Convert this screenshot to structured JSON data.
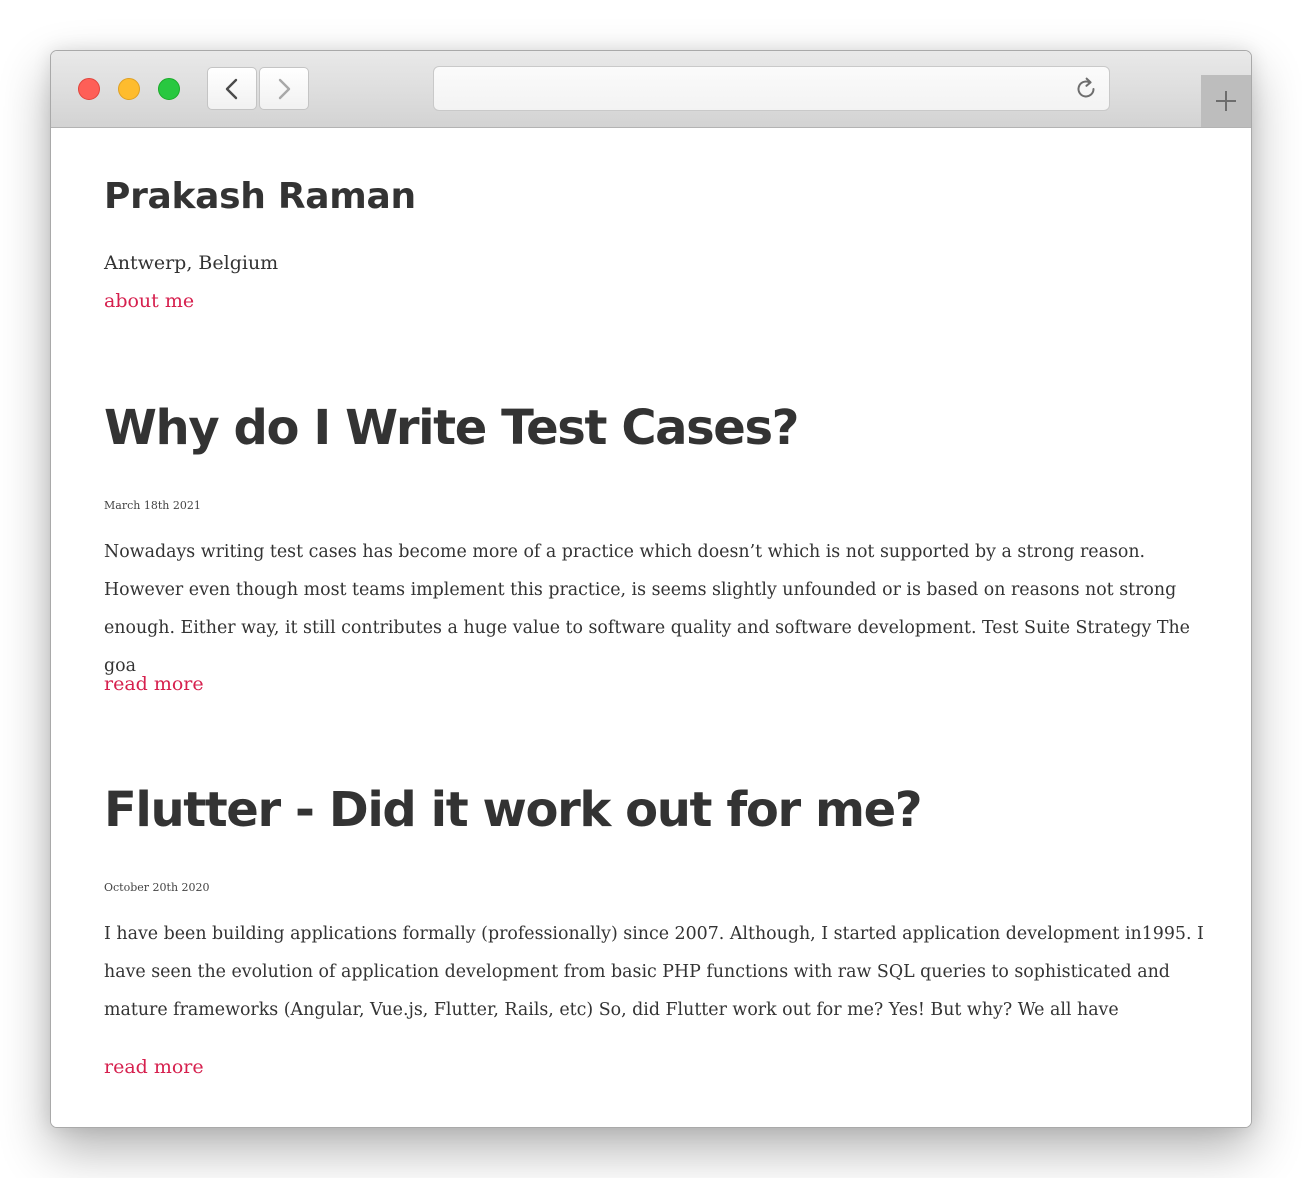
{
  "browser": {
    "url": "",
    "controls": {
      "close": "close-window-icon",
      "minimize": "minimize-window-icon",
      "maximize": "maximize-window-icon",
      "back": "chevron-left-icon",
      "forward": "chevron-right-icon",
      "reload": "reload-icon",
      "new_tab": "plus-icon"
    },
    "colors": {
      "close": "#fe5f57",
      "minimize": "#febc2e",
      "maximize": "#28c840"
    }
  },
  "site": {
    "title": "Prakash Raman",
    "location": "Antwerp, Belgium",
    "about_link": "about me",
    "accent_color": "#d6204e",
    "text_color": "#333333"
  },
  "posts": [
    {
      "title": "Why do I Write Test Cases?",
      "date": "March 18th 2021",
      "excerpt": "Nowadays writing test cases has become more of a practice which doesn’t which is not supported by a strong reason. However even though most teams implement this practice, is seems slightly unfounded or is based on reasons not strong enough. Either way, it still contributes a huge value to software quality and software development. Test Suite Strategy The goa",
      "read_more": "read more"
    },
    {
      "title": "Flutter - Did it work out for me?",
      "date": "October 20th 2020",
      "excerpt": "I have been building applications formally (professionally) since 2007. Although, I started application development in1995. I have seen the evolution of application development from basic PHP functions with raw SQL queries to sophisticated and mature frameworks (Angular, Vue.js, Flutter, Rails, etc) So, did Flutter work out for me? Yes! But why? We all have",
      "read_more": "read more"
    }
  ]
}
